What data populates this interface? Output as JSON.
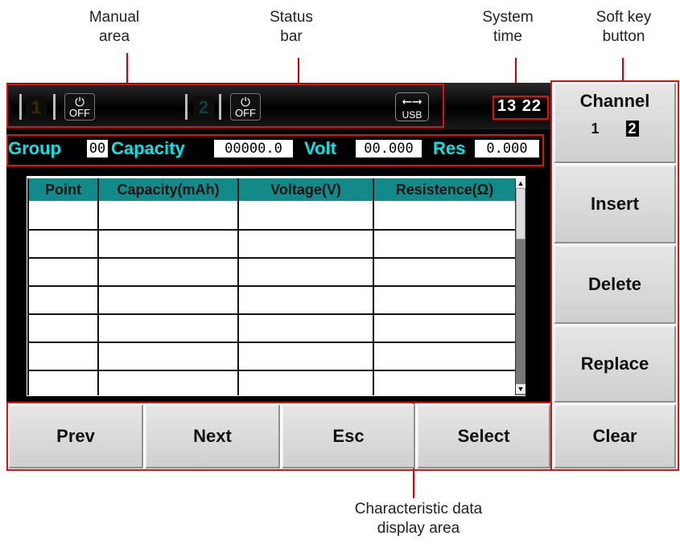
{
  "callouts": {
    "manual_area": "Manual\narea",
    "status_bar": "Status\nbar",
    "system_time": "System\ntime",
    "soft_key": "Soft key\nbutton",
    "characteristic": "Characteristic data\ndisplay area"
  },
  "status": {
    "ch1": "1",
    "ch2": "2",
    "power_off": "OFF",
    "usb": "USB",
    "time": "13 22"
  },
  "params": {
    "group_label": "Group",
    "group_value": "00",
    "capacity_label": "Capacity",
    "capacity_value": "00000.0",
    "volt_label": "Volt",
    "volt_value": "00.000",
    "res_label": "Res",
    "res_value": "0.000"
  },
  "table": {
    "headers": [
      "Point",
      "Capacity(mAh)",
      "Voltage(V)",
      "Resistence(Ω)"
    ]
  },
  "soft_keys": {
    "channel": "Channel",
    "channel_opt1": "1",
    "channel_opt2": "2",
    "insert": "Insert",
    "delete": "Delete",
    "replace": "Replace",
    "clear": "Clear"
  },
  "bottom_keys": {
    "prev": "Prev",
    "next": "Next",
    "esc": "Esc",
    "select": "Select"
  },
  "colors": {
    "accent_cyan": "#00e6e6",
    "header_teal": "#128a8a",
    "annotation_red": "#e01010"
  }
}
